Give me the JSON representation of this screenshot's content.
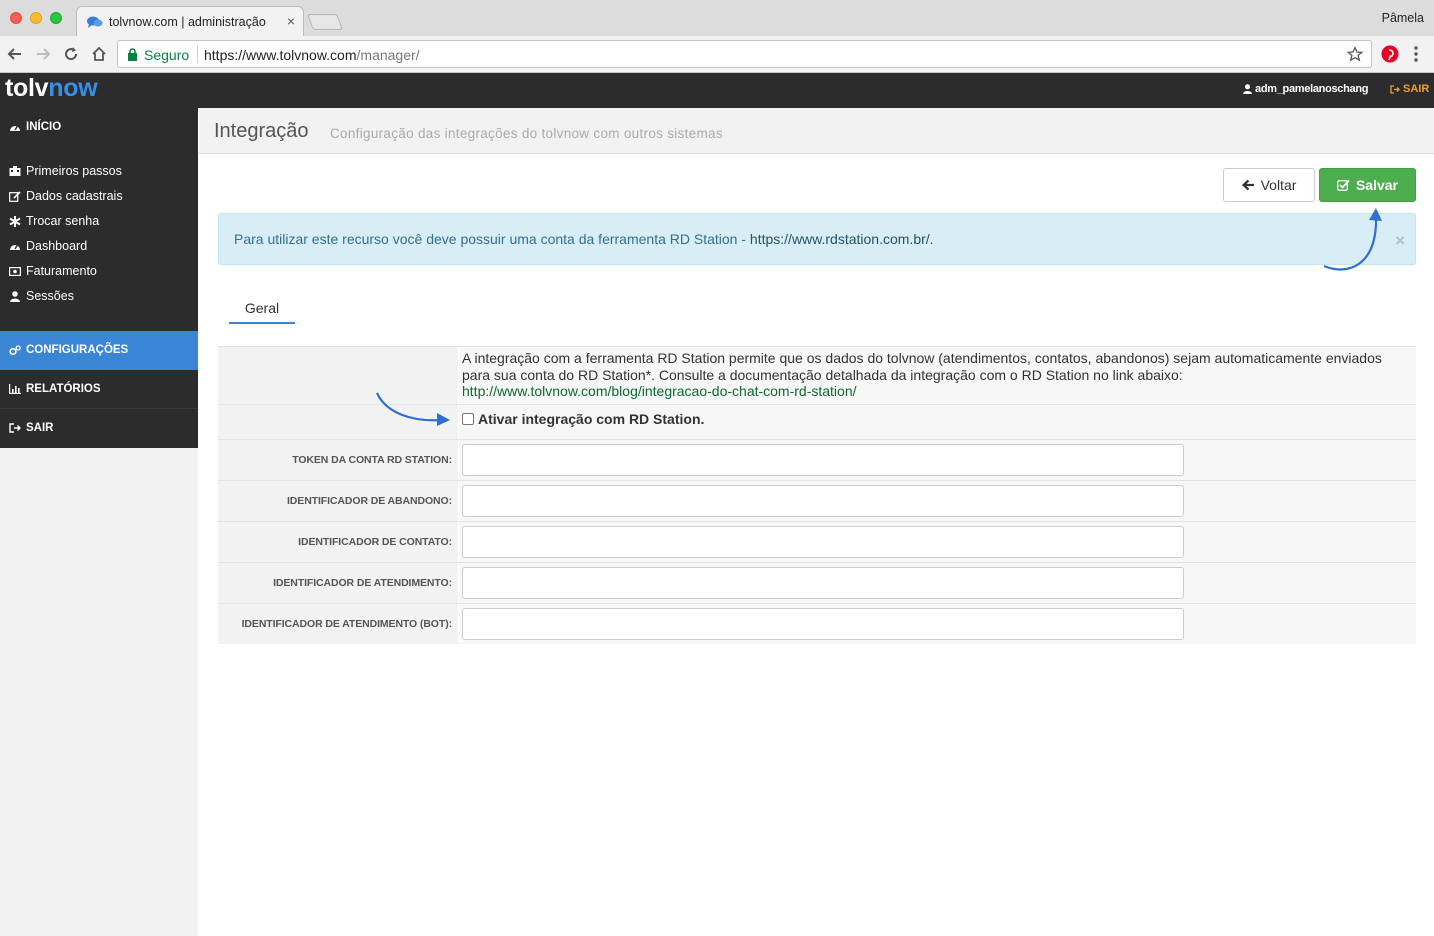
{
  "browser": {
    "tab_title": "tolvnow.com | administração",
    "tab_close": "×",
    "profile_name": "Pâmela",
    "secure_label": "Seguro",
    "url_host": "https://www.tolvnow.com",
    "url_path": "/manager/"
  },
  "header": {
    "logo_part1": "tolv",
    "logo_part2": "now",
    "username": "adm_pamelanoschang",
    "logout_label": "SAIR"
  },
  "sidebar": {
    "home": "INÍCIO",
    "items": [
      {
        "label": "Primeiros passos",
        "icon": "building-icon"
      },
      {
        "label": "Dados cadastrais",
        "icon": "edit-icon"
      },
      {
        "label": "Trocar senha",
        "icon": "asterisk-icon"
      },
      {
        "label": "Dashboard",
        "icon": "dashboard-icon"
      },
      {
        "label": "Faturamento",
        "icon": "money-icon"
      },
      {
        "label": "Sessões",
        "icon": "user-icon"
      }
    ],
    "config": "CONFIGURAÇÕES",
    "reports": "RELATÓRIOS",
    "logout": "SAIR"
  },
  "page": {
    "title": "Integração",
    "subtitle": "Configuração das integrações do tolvnow com outros sistemas"
  },
  "actions": {
    "back_label": "Voltar",
    "save_label": "Salvar"
  },
  "alert": {
    "text": "Para utilizar este recurso você deve possuir uma conta da ferramenta RD Station - ",
    "link": "https://www.rdstation.com.br/.",
    "close": "×"
  },
  "tabs": {
    "general": "Geral"
  },
  "form": {
    "description": "A integração com a ferramenta RD Station permite que os dados do tolvnow (atendimentos, contatos, abandonos) sejam automaticamente enviados para sua conta do RD Station*. Consulte a documentação detalhada da integração com o RD Station no link abaixo:",
    "doc_link": "http://www.tolvnow.com/blog/integracao-do-chat-com-rd-station/",
    "checkbox_label": "Ativar integração com RD Station.",
    "checkbox_checked": false,
    "fields": [
      {
        "label": "TOKEN DA CONTA RD STATION:",
        "value": ""
      },
      {
        "label": "IDENTIFICADOR DE ABANDONO:",
        "value": ""
      },
      {
        "label": "IDENTIFICADOR DE CONTATO:",
        "value": ""
      },
      {
        "label": "IDENTIFICADOR DE ATENDIMENTO:",
        "value": ""
      },
      {
        "label": "IDENTIFICADOR DE ATENDIMENTO (BOT):",
        "value": ""
      }
    ]
  },
  "colors": {
    "primary": "#3a86d4",
    "success": "#4cae4c",
    "header_bg": "#2c2c2c",
    "alert_bg": "#d9edf7",
    "logout_accent": "#f0a030"
  }
}
